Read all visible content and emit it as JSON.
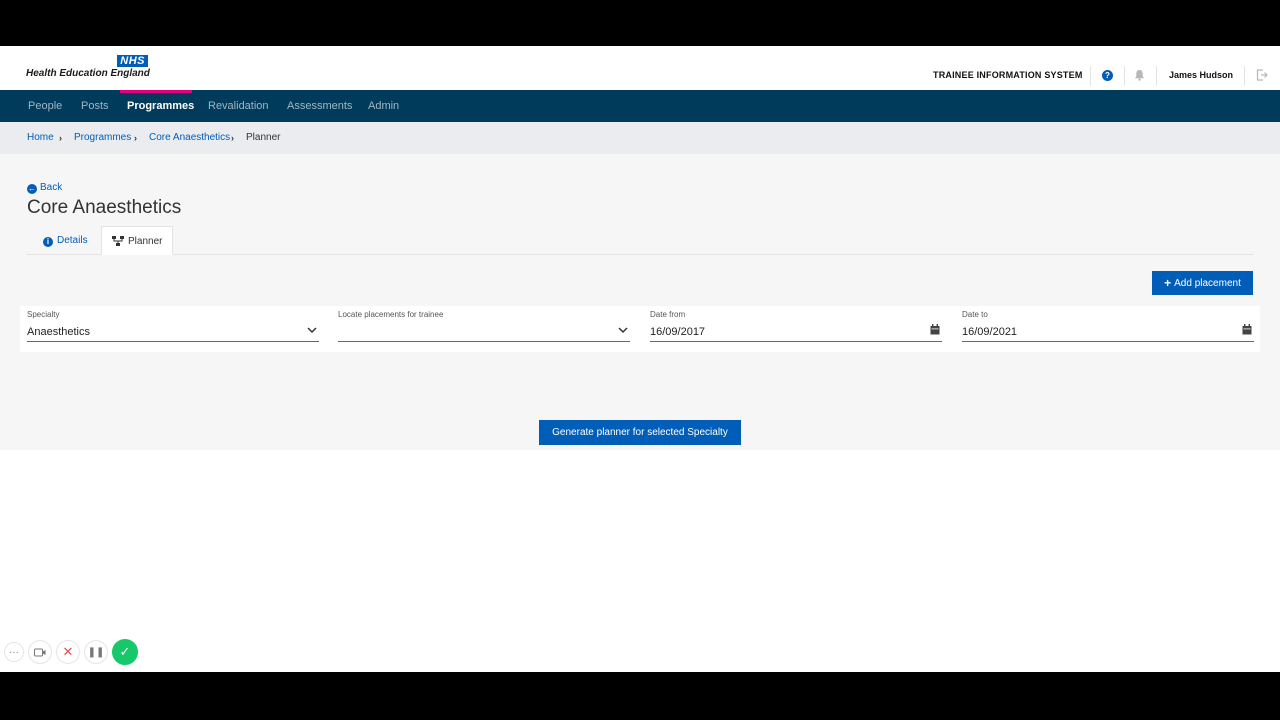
{
  "header": {
    "nhs_badge": "NHS",
    "org_name": "Health Education England",
    "system_title": "TRAINEE INFORMATION SYSTEM",
    "help_symbol": "?",
    "user_name": "James Hudson",
    "icons": [
      "help-icon",
      "bell-icon",
      "logout-icon"
    ]
  },
  "nav": {
    "items": [
      {
        "label": "People"
      },
      {
        "label": "Posts"
      },
      {
        "label": "Programmes",
        "active": true
      },
      {
        "label": "Revalidation"
      },
      {
        "label": "Assessments"
      },
      {
        "label": "Admin"
      }
    ],
    "active_color": "#e5007e"
  },
  "breadcrumb": {
    "items": [
      {
        "label": "Home"
      },
      {
        "label": "Programmes"
      },
      {
        "label": "Core Anaesthetics"
      },
      {
        "label": "Planner"
      }
    ]
  },
  "page": {
    "back_label": "Back",
    "title": "Core Anaesthetics",
    "tabs": [
      {
        "label": "Details",
        "icon": "info-icon"
      },
      {
        "label": "Planner",
        "icon": "sitemap-icon",
        "active": true
      }
    ],
    "add_button_label": "Add placement",
    "generate_button_label": "Generate planner for selected Specialty"
  },
  "filters": {
    "specialty": {
      "label": "Specialty",
      "value": "Anaesthetics"
    },
    "trainee": {
      "label": "Locate placements for trainee",
      "value": ""
    },
    "date_from": {
      "label": "Date from",
      "value": "16/09/2017"
    },
    "date_to": {
      "label": "Date to",
      "value": "16/09/2021"
    }
  },
  "recorder": {
    "buttons": [
      "more-icon",
      "camera-icon",
      "close-icon",
      "pause-icon",
      "check-icon"
    ]
  },
  "colors": {
    "brand_blue": "#005eb8",
    "nav_bg": "#003b5c",
    "confirm_green": "#16c86a"
  }
}
